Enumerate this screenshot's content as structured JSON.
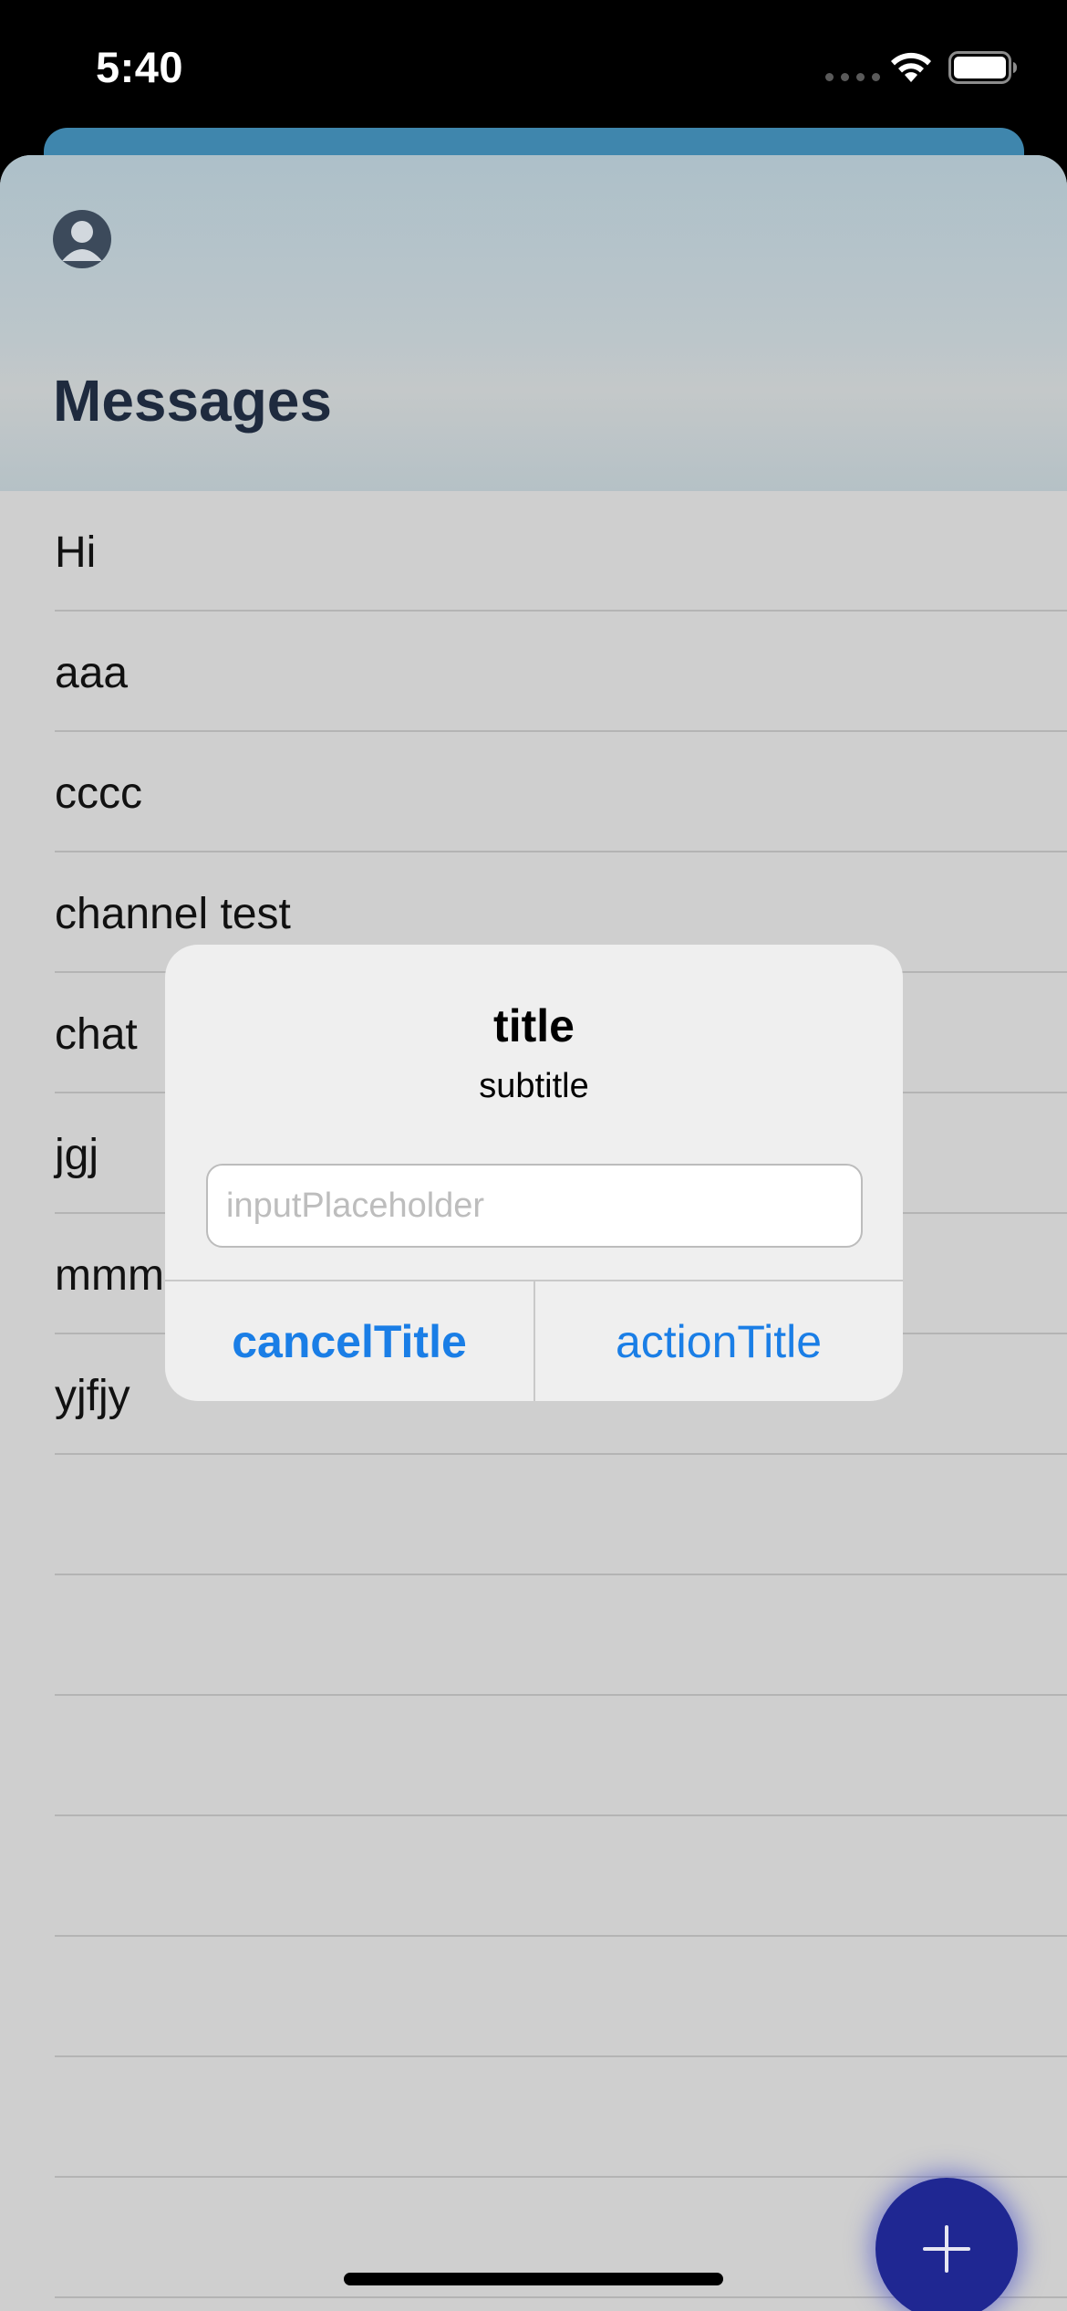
{
  "status_bar": {
    "time": "5:40"
  },
  "header": {
    "title": "Messages",
    "avatar_icon": "person-circle-icon"
  },
  "channels": [
    {
      "label": "Hi"
    },
    {
      "label": "aaa"
    },
    {
      "label": "cccc"
    },
    {
      "label": "channel test"
    },
    {
      "label": "chat"
    },
    {
      "label": "jgj"
    },
    {
      "label": "mmm"
    },
    {
      "label": "yjfjy"
    },
    {
      "label": ""
    },
    {
      "label": ""
    },
    {
      "label": ""
    },
    {
      "label": ""
    },
    {
      "label": ""
    },
    {
      "label": ""
    },
    {
      "label": ""
    }
  ],
  "alert": {
    "title": "title",
    "subtitle": "subtitle",
    "input_placeholder": "inputPlaceholder",
    "input_value": "",
    "cancel_label": "cancelTitle",
    "action_label": "actionTitle"
  },
  "fab": {
    "icon": "plus-icon"
  },
  "colors": {
    "accent": "#1a7ee6",
    "fab": "#1f2792",
    "title": "#1e2a3e"
  }
}
